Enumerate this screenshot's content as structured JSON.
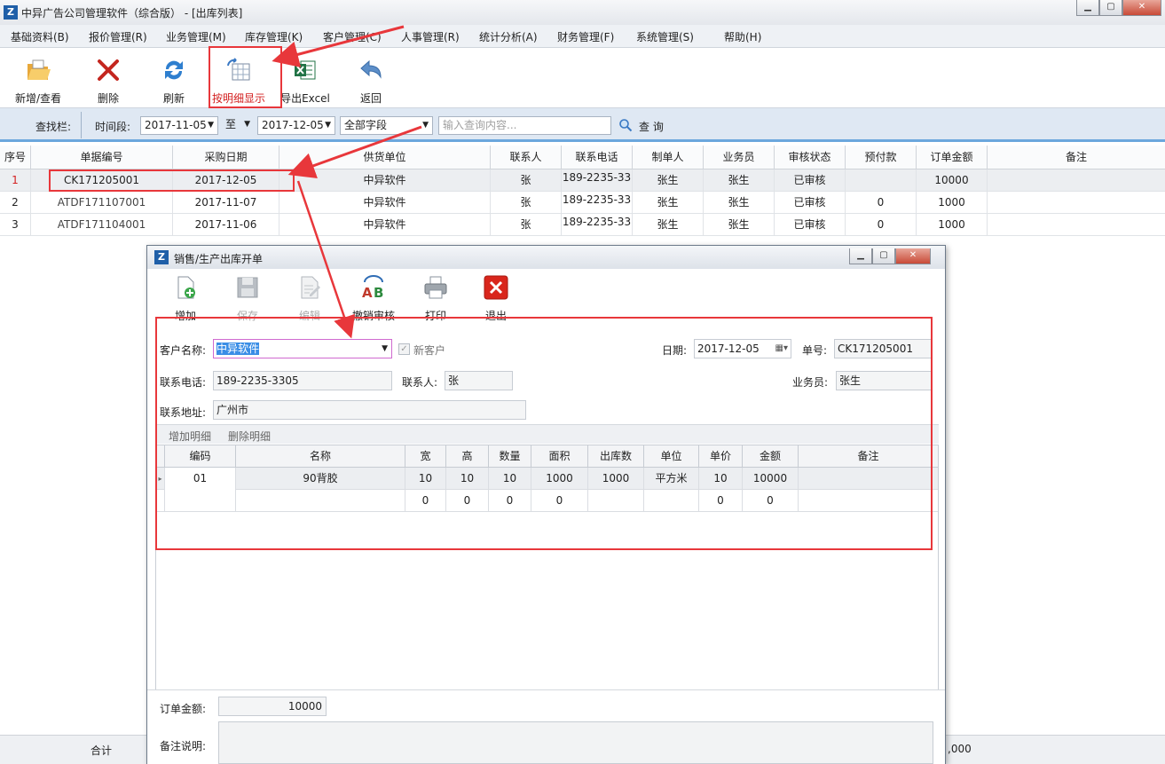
{
  "app": {
    "title": "中异广告公司管理软件（综合版） - [出库列表]",
    "logo_text": "Z"
  },
  "window_buttons": [
    "▁",
    "▢",
    "✕"
  ],
  "menu": [
    "基础资料(B)",
    "报价管理(R)",
    "业务管理(M)",
    "库存管理(K)",
    "客户管理(C)",
    "人事管理(R)",
    "统计分析(A)",
    "财务管理(F)",
    "系统管理(S)",
    "帮助(H)"
  ],
  "toolbar": {
    "new_view": "新增/查看",
    "delete": "删除",
    "refresh": "刷新",
    "show_detail": "按明细显示",
    "export_excel": "导出Excel",
    "back": "返回"
  },
  "searchbar": {
    "label": "查找栏:",
    "period_label": "时间段:",
    "date_from": "2017-11-05",
    "to": "至",
    "date_to": "2017-12-05",
    "field": "全部字段",
    "query_placeholder": "输入查询内容...",
    "query_button": "查 询"
  },
  "grid": {
    "columns": [
      "序号",
      "单据编号",
      "采购日期",
      "供货单位",
      "联系人",
      "联系电话",
      "制单人",
      "业务员",
      "审核状态",
      "预付款",
      "订单金额",
      "备注"
    ],
    "rows": [
      [
        "1",
        "CK171205001",
        "2017-12-05",
        "中异软件",
        "张",
        "189-2235-33",
        "张生",
        "张生",
        "已审核",
        "",
        "10000",
        ""
      ],
      [
        "2",
        "ATDF171107001",
        "2017-11-07",
        "中异软件",
        "张",
        "189-2235-33",
        "张生",
        "张生",
        "已审核",
        "0",
        "1000",
        ""
      ],
      [
        "3",
        "ATDF171104001",
        "2017-11-06",
        "中异软件",
        "张",
        "189-2235-33",
        "张生",
        "张生",
        "已审核",
        "0",
        "1000",
        ""
      ]
    ]
  },
  "footer": {
    "total_label": "合计",
    "total_value_partial": ",000"
  },
  "dialog": {
    "title": "销售/生产出库开单",
    "toolbar": {
      "add": "增加",
      "save": "保存",
      "edit": "编辑",
      "unapprove": "撤销审核",
      "print": "打印",
      "exit": "退出"
    },
    "form": {
      "customer_label": "客户名称:",
      "customer_value": "中异软件",
      "new_customer": "新客户",
      "date_label": "日期:",
      "date_value": "2017-12-05",
      "order_no_label": "单号:",
      "order_no_value": "CK171205001",
      "phone_label": "联系电话:",
      "phone_value": "189-2235-3305",
      "contact_label": "联系人:",
      "contact_value": "张",
      "salesman_label": "业务员:",
      "salesman_value": "张生",
      "address_label": "联系地址:",
      "address_value": "广州市"
    },
    "detail": {
      "add_detail": "增加明细",
      "delete_detail": "删除明细",
      "columns": [
        "编码",
        "名称",
        "宽",
        "高",
        "数量",
        "面积",
        "出库数",
        "单位",
        "单价",
        "金额",
        "备注"
      ],
      "rows": [
        [
          "01",
          "90背胶",
          "10",
          "10",
          "10",
          "1000",
          "1000",
          "平方米",
          "10",
          "10000",
          ""
        ],
        [
          "",
          "",
          "0",
          "0",
          "0",
          "0",
          "",
          "",
          "0",
          "0",
          ""
        ]
      ]
    },
    "summary": {
      "amount_label": "订单金额:",
      "amount_value": "10000",
      "remark_label": "备注说明:"
    }
  },
  "colors": {
    "highlight_red": "#e8373b",
    "accent_blue": "#1f5fa8"
  }
}
